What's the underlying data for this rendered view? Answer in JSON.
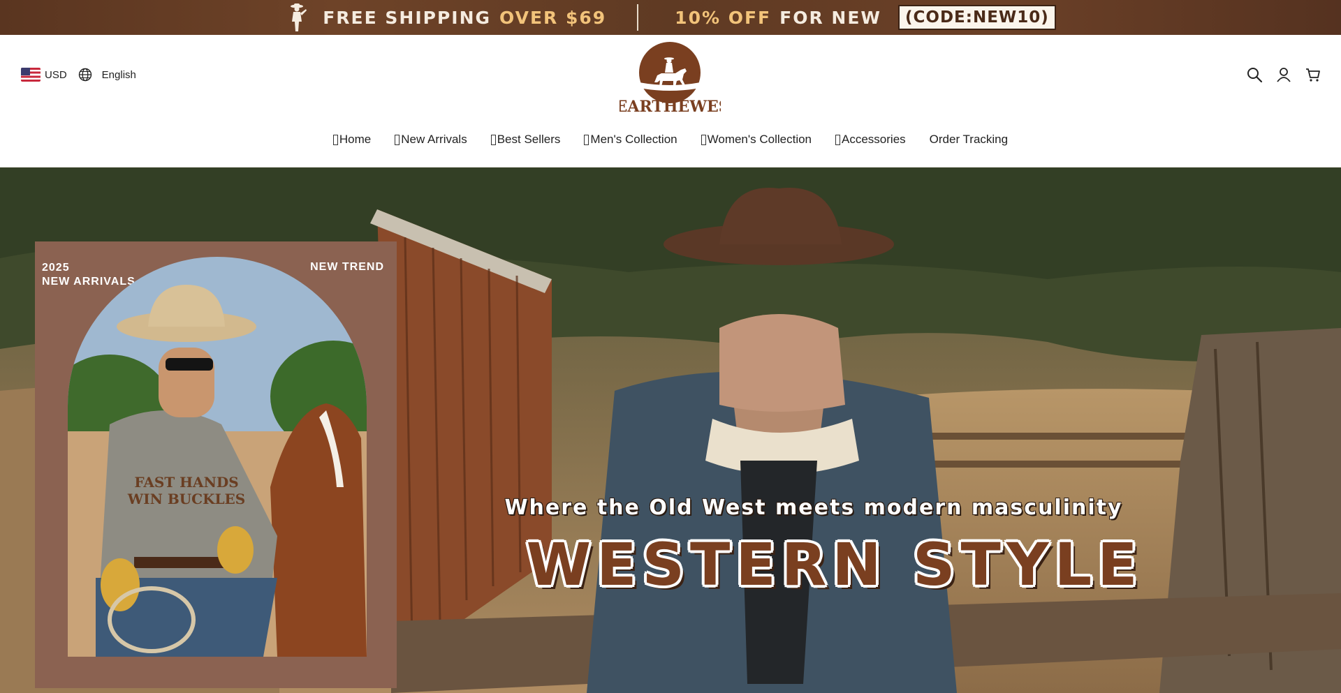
{
  "announcement": {
    "part1_white": "FREE SHIPPING",
    "part1_gold": "OVER $69",
    "part2_gold": "10% OFF",
    "part2_white": "FOR NEW",
    "code": "(CODE:NEW10)"
  },
  "header": {
    "currency": "USD",
    "language": "English",
    "logo_text": "WEARTHEWEST"
  },
  "nav": {
    "items": [
      {
        "label": "Home",
        "has_icon": true
      },
      {
        "label": "New Arrivals",
        "has_icon": true
      },
      {
        "label": "Best Sellers",
        "has_icon": true
      },
      {
        "label": "Men's Collection",
        "has_icon": true
      },
      {
        "label": "Women's Collection",
        "has_icon": true
      },
      {
        "label": "Accessories",
        "has_icon": true
      },
      {
        "label": "Order Tracking",
        "has_icon": false
      }
    ]
  },
  "hero": {
    "promo_year": "2025",
    "promo_arrivals": "NEW  ARRIVALS",
    "promo_trend": "NEW TREND",
    "shirt_text": "FAST HANDS WIN BUCKLES",
    "tagline": "Where the Old West meets modern masculinity",
    "headline": "Western Style"
  },
  "icons": [
    "cowboy-rider-icon",
    "us-flag-icon",
    "globe-icon",
    "search-icon",
    "account-icon",
    "cart-icon"
  ],
  "colors": {
    "brand_brown": "#7a3f20",
    "announce_bg": "#5f3a23",
    "announce_gold": "#f2c37a",
    "promo_card": "#8b6251"
  }
}
